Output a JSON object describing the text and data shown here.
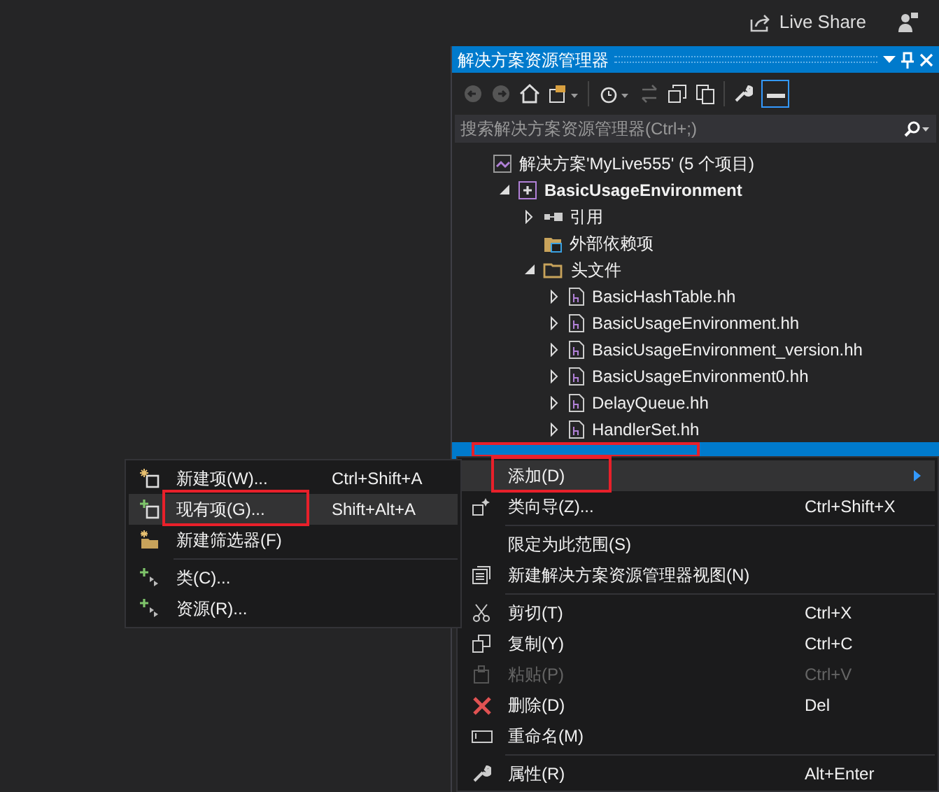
{
  "top_bar": {
    "live_share": "Live Share"
  },
  "panel": {
    "title": "解决方案资源管理器",
    "search": {
      "placeholder": "搜索解决方案资源管理器(Ctrl+;)"
    }
  },
  "tree": [
    {
      "label": "解决方案'MyLive555' (5 个项目)",
      "kind": "solution",
      "children": [
        {
          "label": "BasicUsageEnvironment",
          "kind": "project",
          "expanded": true,
          "children": [
            {
              "label": "引用",
              "kind": "references",
              "expanded": false
            },
            {
              "label": "外部依赖项",
              "kind": "external"
            },
            {
              "label": "头文件",
              "kind": "folder",
              "expanded": true,
              "children": [
                {
                  "label": "BasicHashTable.hh",
                  "kind": "file",
                  "expanded": false
                },
                {
                  "label": "BasicUsageEnvironment.hh",
                  "kind": "file",
                  "expanded": false
                },
                {
                  "label": "BasicUsageEnvironment_version.hh",
                  "kind": "file",
                  "expanded": false
                },
                {
                  "label": "BasicUsageEnvironment0.hh",
                  "kind": "file",
                  "expanded": false
                },
                {
                  "label": "DelayQueue.hh",
                  "kind": "file",
                  "expanded": false
                },
                {
                  "label": "HandlerSet.hh",
                  "kind": "file",
                  "expanded": false
                }
              ]
            },
            {
              "kind": "covered",
              "selected": true,
              "highlighted": true
            }
          ]
        }
      ]
    }
  ],
  "context_menu": [
    {
      "label": "添加(D)",
      "kind": "submenu",
      "highlighted": true,
      "hovered": true
    },
    {
      "label": "类向导(Z)...",
      "shortcut": "Ctrl+Shift+X",
      "kind": "wizard"
    },
    {
      "kind": "separator"
    },
    {
      "label": "限定为此范围(S)",
      "kind": "plain"
    },
    {
      "label": "新建解决方案资源管理器视图(N)",
      "kind": "view"
    },
    {
      "kind": "separator"
    },
    {
      "label": "剪切(T)",
      "shortcut": "Ctrl+X",
      "kind": "cut"
    },
    {
      "label": "复制(Y)",
      "shortcut": "Ctrl+C",
      "kind": "copy"
    },
    {
      "label": "粘贴(P)",
      "shortcut": "Ctrl+V",
      "kind": "paste",
      "disabled": true
    },
    {
      "label": "删除(D)",
      "shortcut": "Del",
      "kind": "delete"
    },
    {
      "label": "重命名(M)",
      "kind": "rename"
    },
    {
      "kind": "separator"
    },
    {
      "label": "属性(R)",
      "shortcut": "Alt+Enter",
      "kind": "properties"
    }
  ],
  "submenu": [
    {
      "label": "新建项(W)...",
      "shortcut": "Ctrl+Shift+A",
      "kind": "new",
      "hovered": false
    },
    {
      "label": "现有项(G)...",
      "shortcut": "Shift+Alt+A",
      "kind": "existing",
      "hovered": true,
      "highlighted": true
    },
    {
      "label": "新建筛选器(F)",
      "kind": "filter",
      "hovered": false
    },
    {
      "kind": "separator"
    },
    {
      "label": "类(C)...",
      "kind": "class",
      "hovered": false
    },
    {
      "label": "资源(R)...",
      "kind": "resource",
      "hovered": false
    }
  ]
}
